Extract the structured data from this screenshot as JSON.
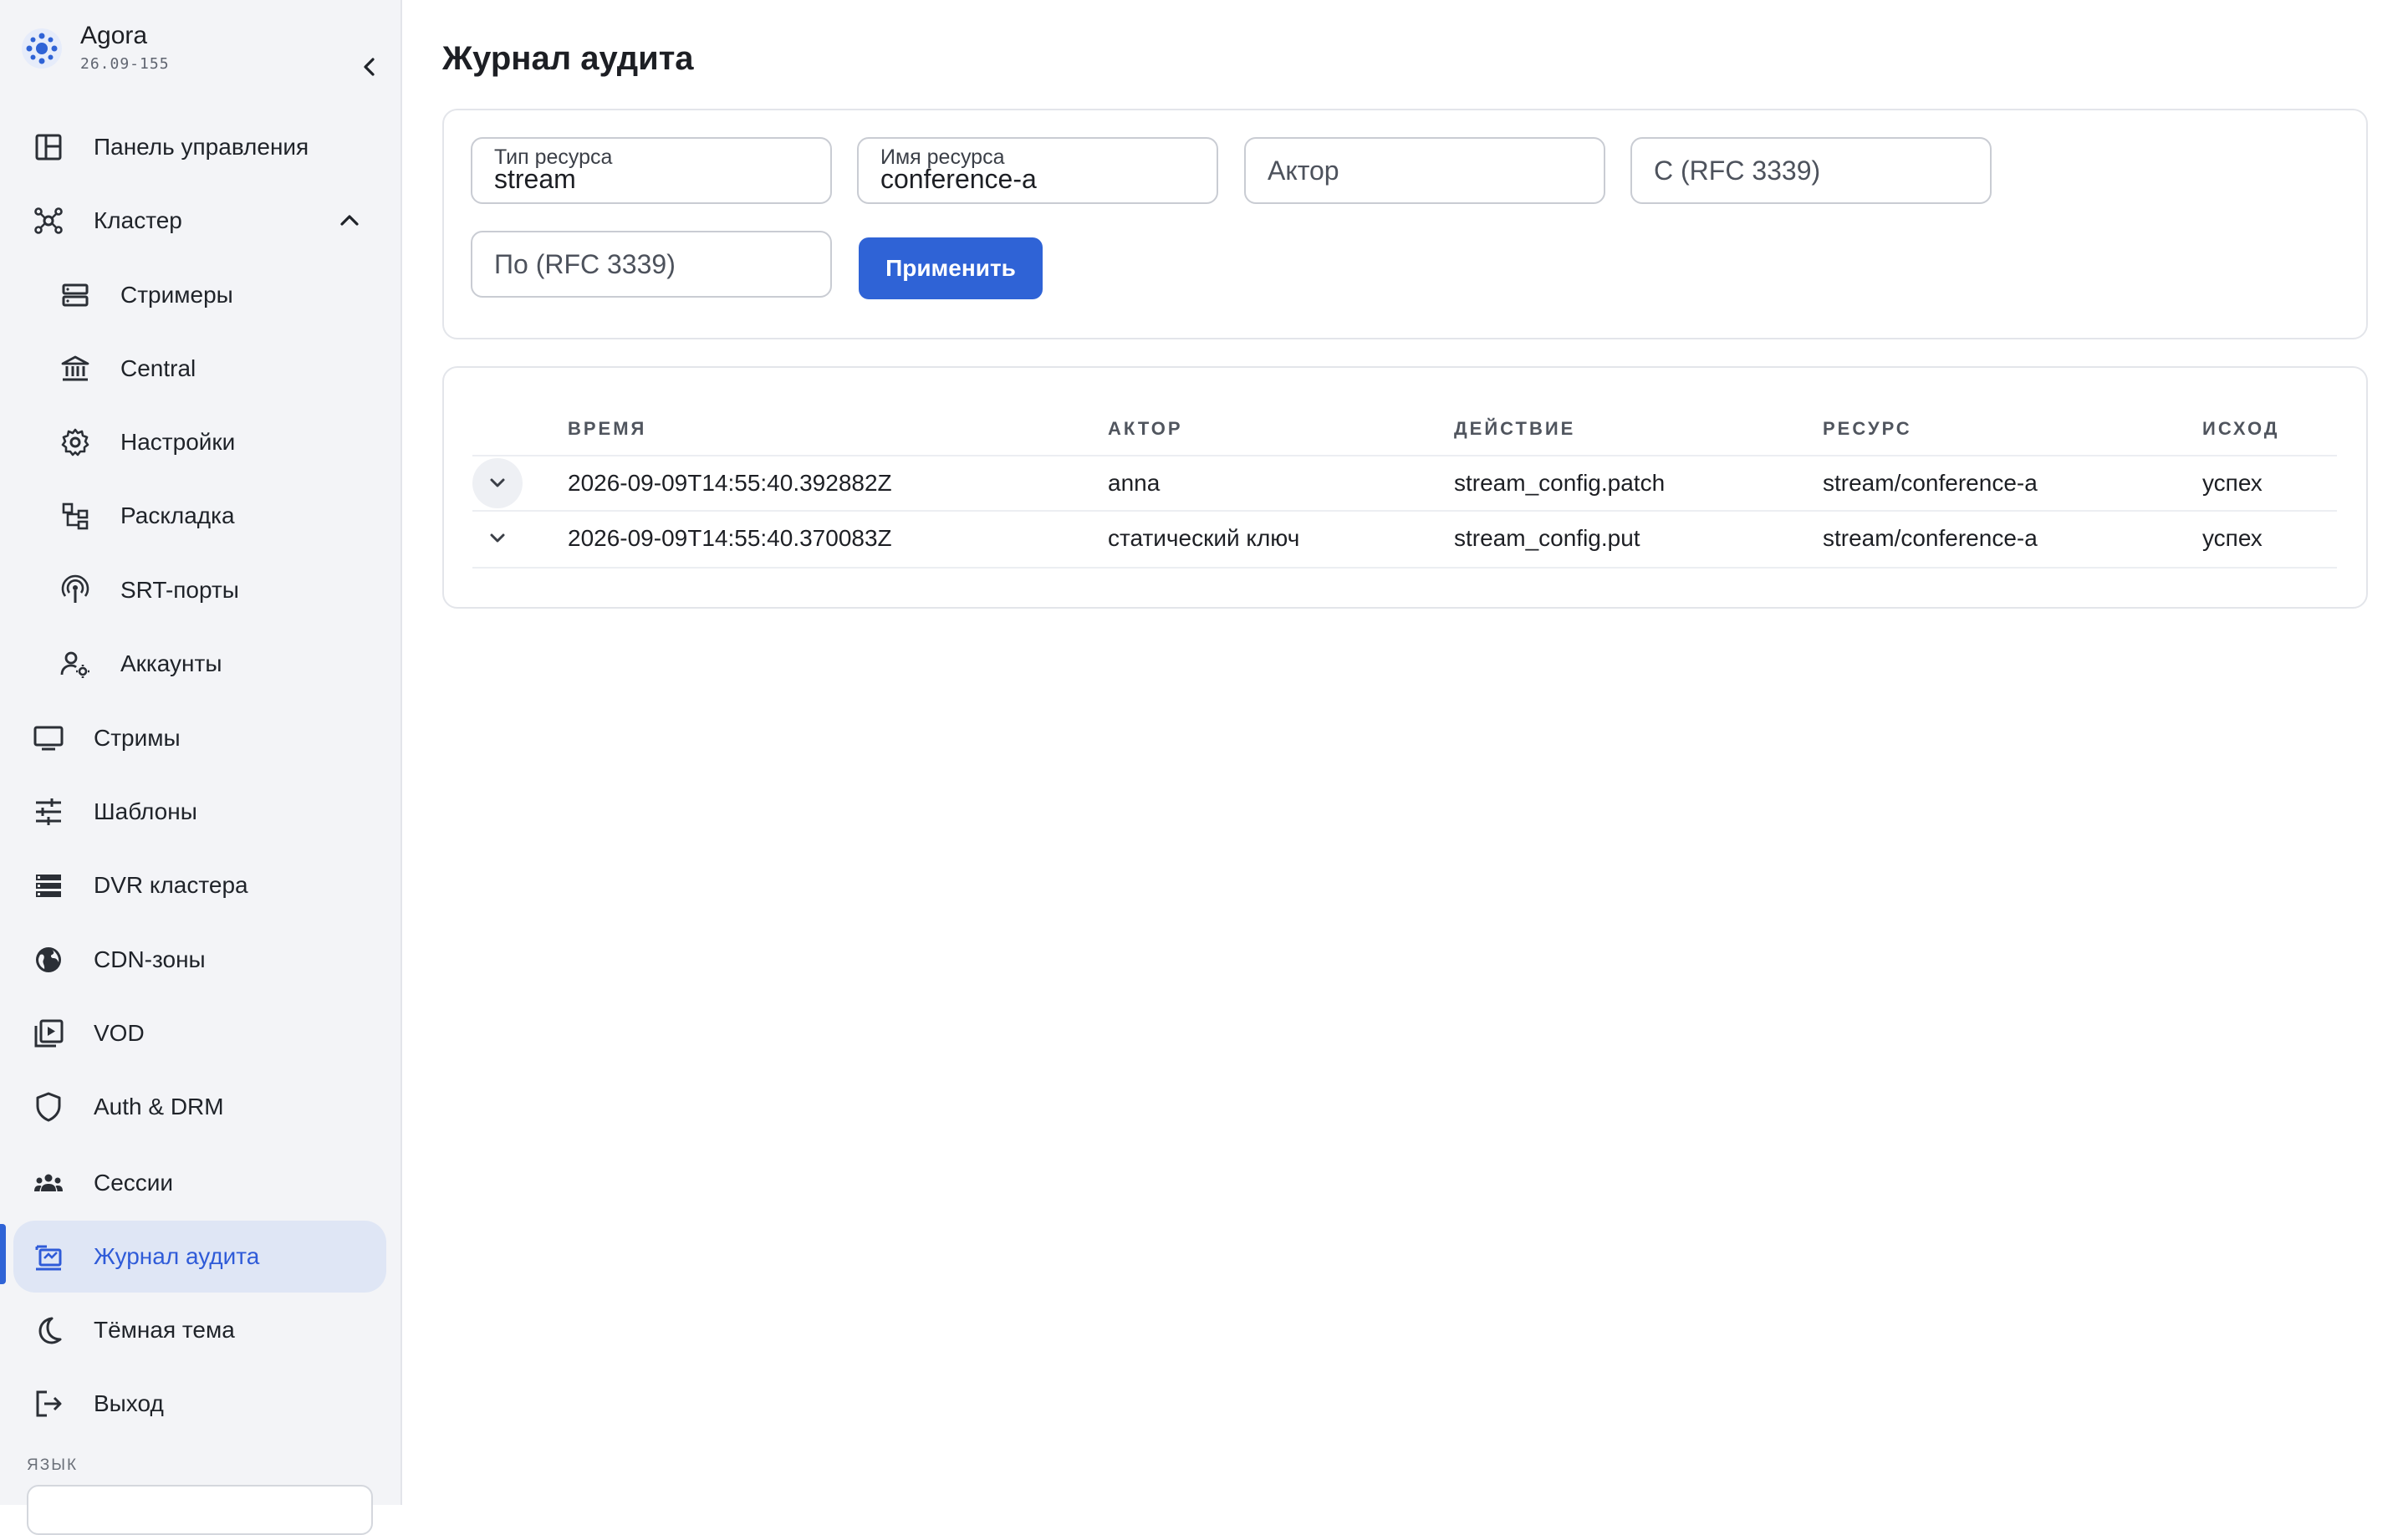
{
  "app": {
    "name": "Agora",
    "version": "26.09-155"
  },
  "sidebar": {
    "items": [
      {
        "label": "Панель управления",
        "icon": "dashboard-icon"
      },
      {
        "label": "Кластер",
        "icon": "cluster-icon"
      },
      {
        "label": "Стримеры",
        "icon": "server-icon"
      },
      {
        "label": "Central",
        "icon": "bank-icon"
      },
      {
        "label": "Настройки",
        "icon": "gear-icon"
      },
      {
        "label": "Раскладка",
        "icon": "layout-tree-icon"
      },
      {
        "label": "SRT-порты",
        "icon": "antenna-icon"
      },
      {
        "label": "Аккаунты",
        "icon": "user-settings-icon"
      },
      {
        "label": "Стримы",
        "icon": "monitor-icon"
      },
      {
        "label": "Шаблоны",
        "icon": "sliders-icon"
      },
      {
        "label": "DVR кластера",
        "icon": "storage-icon"
      },
      {
        "label": "CDN-зоны",
        "icon": "globe-icon"
      },
      {
        "label": "VOD",
        "icon": "video-library-icon"
      },
      {
        "label": "Auth & DRM",
        "icon": "shield-icon"
      },
      {
        "label": "Сессии",
        "icon": "group-icon"
      },
      {
        "label": "Журнал аудита",
        "icon": "audit-icon"
      },
      {
        "label": "Тёмная тема",
        "icon": "moon-icon"
      },
      {
        "label": "Выход",
        "icon": "logout-icon"
      }
    ],
    "active": "Журнал аудита",
    "language_label": "ЯЗЫК"
  },
  "page": {
    "title": "Журнал аудита"
  },
  "filters": {
    "resource_type": {
      "label": "Тип ресурса",
      "value": "stream"
    },
    "resource_name": {
      "label": "Имя ресурса",
      "value": "conference-a"
    },
    "actor": {
      "placeholder": "Актор"
    },
    "from": {
      "placeholder": "С (RFC 3339)"
    },
    "to": {
      "placeholder": "По (RFC 3339)"
    },
    "apply_label": "Применить"
  },
  "table": {
    "columns": [
      "ВРЕМЯ",
      "АКТОР",
      "ДЕЙСТВИЕ",
      "РЕСУРС",
      "ИСХОД"
    ],
    "rows": [
      [
        "2026-09-09T14:55:40.392882Z",
        "anna",
        "stream_config.patch",
        "stream/conference-a",
        "успех"
      ],
      [
        "2026-09-09T14:55:40.370083Z",
        "статический ключ",
        "stream_config.put",
        "stream/conference-a",
        "успех"
      ]
    ]
  },
  "colors": {
    "accent": "#2f63d6",
    "active_bg": "#dfe6f5",
    "sidebar_bg": "#f3f4f7"
  }
}
